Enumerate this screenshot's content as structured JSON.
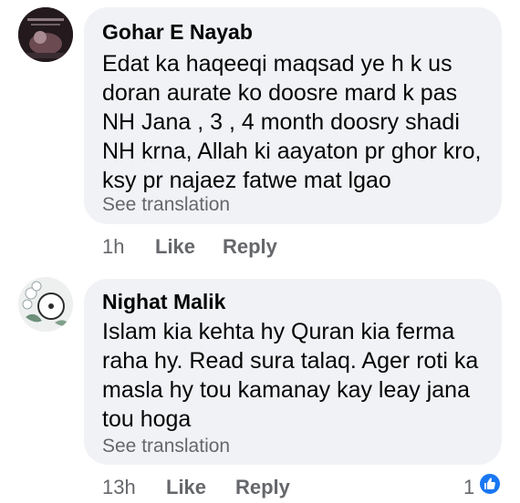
{
  "comments": [
    {
      "author": "Gohar E Nayab",
      "avatar_icon": "profile-photo-dark-icon",
      "text": "Edat ka haqeeqi maqsad ye h k us\ndoran aurate ko doosre mard k pas\nNH Jana , 3 , 4 month doosry shadi\nNH krna, Allah ki aayaton pr ghor kro,\nksy pr najaez fatwe mat lgao",
      "see_translation": "See translation",
      "time": "1h",
      "like_label": "Like",
      "reply_label": "Reply"
    },
    {
      "author": "Nighat Malik",
      "avatar_icon": "profile-photo-floral-icon",
      "text": "Islam kia kehta hy Quran kia ferma\nraha hy. Read sura talaq. Ager roti ka\nmasla hy tou kamanay kay leay jana\ntou hoga",
      "see_translation": "See translation",
      "time": "13h",
      "like_label": "Like",
      "reply_label": "Reply",
      "reaction_count": "1",
      "reaction_icon": "thumbs-up-icon"
    }
  ],
  "colors": {
    "bubble": "#f0f2f5",
    "secondary_text": "#65676b",
    "like_blue": "#1877f2"
  }
}
